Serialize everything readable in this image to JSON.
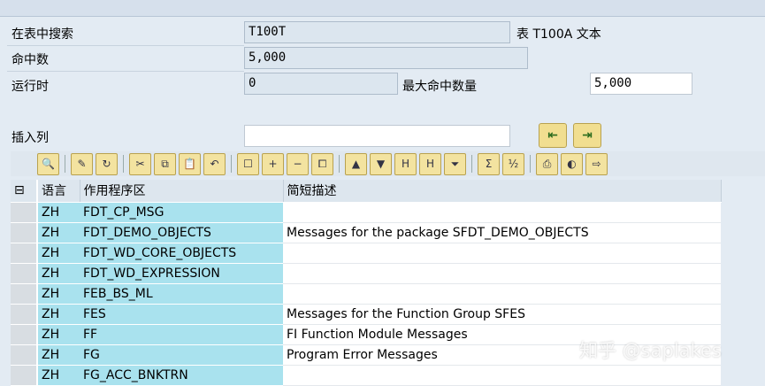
{
  "form": {
    "search_label": "在表中搜索",
    "search_value": "T100T",
    "table_desc": "表 T100A 文本",
    "hits_label": "命中数",
    "hits_value": "5,000",
    "runtime_label": "运行时",
    "runtime_value": "0",
    "max_hits_label": "最大命中数量",
    "max_hits_value": "5,000",
    "insert_col_label": "插入列",
    "insert_col_value": ""
  },
  "table": {
    "headers": [
      "语言",
      "作用程序区",
      "简短描述"
    ],
    "rows": [
      [
        "ZH",
        "FDT_CP_MSG",
        ""
      ],
      [
        "ZH",
        "FDT_DEMO_OBJECTS",
        "Messages for the package SFDT_DEMO_OBJECTS"
      ],
      [
        "ZH",
        "FDT_WD_CORE_OBJECTS",
        ""
      ],
      [
        "ZH",
        "FDT_WD_EXPRESSION",
        ""
      ],
      [
        "ZH",
        "FEB_BS_ML",
        ""
      ],
      [
        "ZH",
        "FES",
        "Messages for the Function Group SFES"
      ],
      [
        "ZH",
        "FF",
        "FI Function Module Messages"
      ],
      [
        "ZH",
        "FG",
        "Program Error Messages"
      ],
      [
        "ZH",
        "FG_ACC_BNKTRN",
        ""
      ]
    ]
  },
  "watermark": "知乎 @saplakes"
}
